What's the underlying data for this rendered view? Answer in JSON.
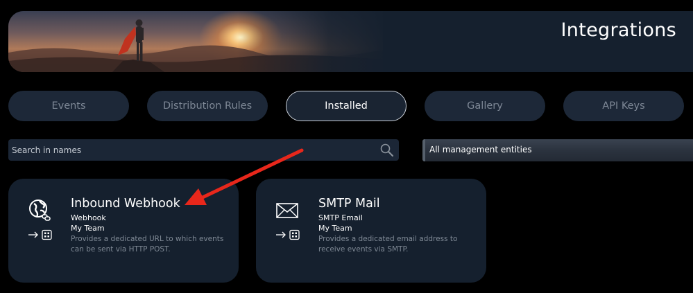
{
  "header": {
    "title": "Integrations"
  },
  "tabs": [
    {
      "label": "Events",
      "active": false
    },
    {
      "label": "Distribution Rules",
      "active": false
    },
    {
      "label": "Installed",
      "active": true
    },
    {
      "label": "Gallery",
      "active": false
    },
    {
      "label": "API Keys",
      "active": false
    }
  ],
  "search": {
    "placeholder": "Search in names",
    "value": "",
    "icon": "search-icon"
  },
  "filter": {
    "selected": "All management entities"
  },
  "cards": [
    {
      "icon": "globe-link-icon",
      "title": "Inbound Webhook",
      "type": "Webhook",
      "team": "My Team",
      "description": "Provides a dedicated URL to which events can be sent via HTTP POST.",
      "action_icon": "arrow-to-grid-icon"
    },
    {
      "icon": "envelope-icon",
      "title": "SMTP Mail",
      "type": "SMTP Email",
      "team": "My Team",
      "description": "Provides a dedicated email address to receive events via SMTP.",
      "action_icon": "arrow-to-grid-icon"
    }
  ],
  "annotation": {
    "color": "#e8271b"
  },
  "colors": {
    "background": "#000000",
    "surface": "#15202e",
    "tab": "#1d2838",
    "muted_text": "#7e8896"
  }
}
